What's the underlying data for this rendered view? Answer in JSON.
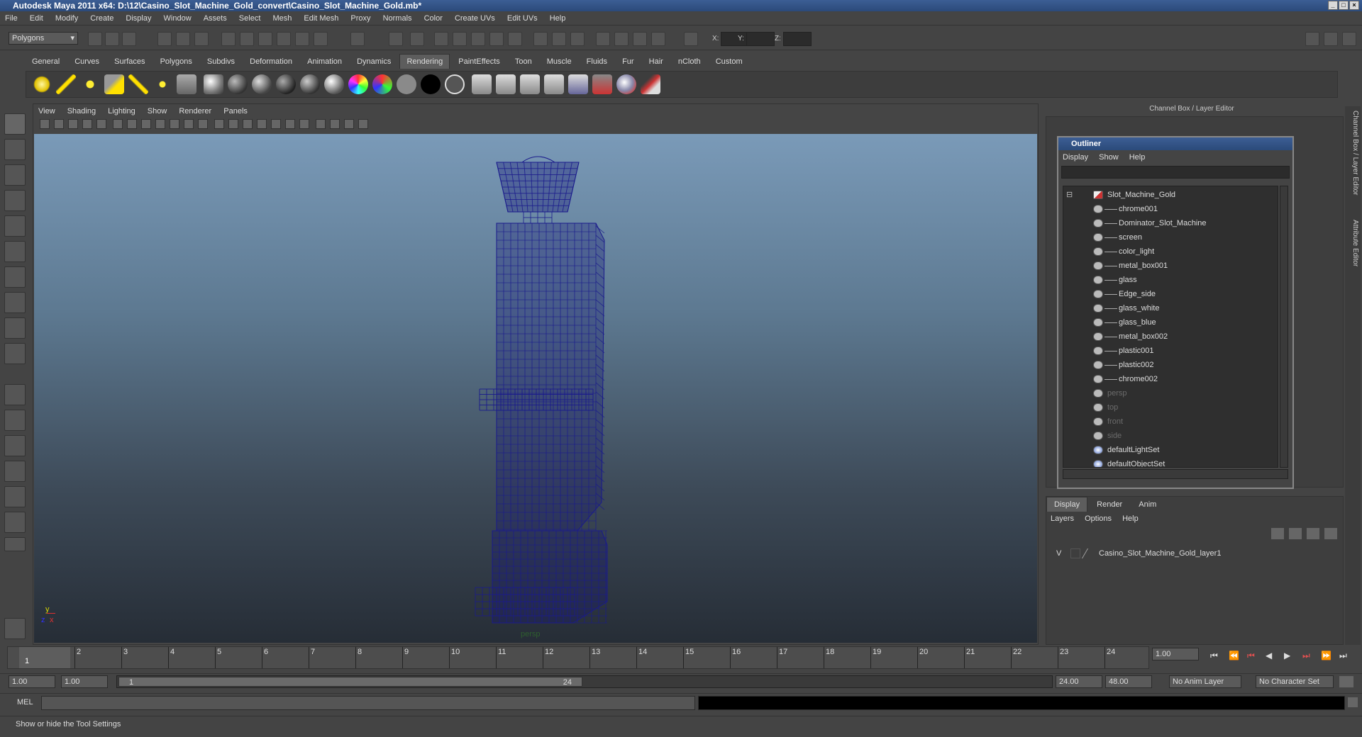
{
  "window": {
    "title": "Autodesk Maya 2011 x64: D:\\12\\Casino_Slot_Machine_Gold_convert\\Casino_Slot_Machine_Gold.mb*"
  },
  "menubar": [
    "File",
    "Edit",
    "Modify",
    "Create",
    "Display",
    "Window",
    "Assets",
    "Select",
    "Mesh",
    "Edit Mesh",
    "Proxy",
    "Normals",
    "Color",
    "Create UVs",
    "Edit UVs",
    "Help"
  ],
  "status_line": {
    "mode": "Polygons",
    "x_label": "X:",
    "y_label": "Y:",
    "z_label": "Z:"
  },
  "shelf_tabs": [
    "General",
    "Curves",
    "Surfaces",
    "Polygons",
    "Subdivs",
    "Deformation",
    "Animation",
    "Dynamics",
    "Rendering",
    "PaintEffects",
    "Toon",
    "Muscle",
    "Fluids",
    "Fur",
    "Hair",
    "nCloth",
    "Custom"
  ],
  "active_shelf_tab": "Rendering",
  "viewport": {
    "menu": [
      "View",
      "Shading",
      "Lighting",
      "Show",
      "Renderer",
      "Panels"
    ],
    "camera_label": "persp",
    "axis_y": "y",
    "axis_z": "z",
    "wire_color": "#1a1a8c"
  },
  "channel_box_header": "Channel Box / Layer Editor",
  "outliner": {
    "title": "Outliner",
    "menu": [
      "Display",
      "Show",
      "Help"
    ],
    "items": [
      {
        "label": "Slot_Machine_Gold",
        "type": "group"
      },
      {
        "label": "chrome001",
        "type": "mesh"
      },
      {
        "label": "Dominator_Slot_Machine",
        "type": "mesh"
      },
      {
        "label": "screen",
        "type": "mesh"
      },
      {
        "label": "color_light",
        "type": "mesh"
      },
      {
        "label": "metal_box001",
        "type": "mesh"
      },
      {
        "label": "glass",
        "type": "mesh"
      },
      {
        "label": "Edge_side",
        "type": "mesh"
      },
      {
        "label": "glass_white",
        "type": "mesh"
      },
      {
        "label": "glass_blue",
        "type": "mesh"
      },
      {
        "label": "metal_box002",
        "type": "mesh"
      },
      {
        "label": "plastic001",
        "type": "mesh"
      },
      {
        "label": "plastic002",
        "type": "mesh"
      },
      {
        "label": "chrome002",
        "type": "mesh"
      },
      {
        "label": "persp",
        "type": "camera"
      },
      {
        "label": "top",
        "type": "camera"
      },
      {
        "label": "front",
        "type": "camera"
      },
      {
        "label": "side",
        "type": "camera"
      },
      {
        "label": "defaultLightSet",
        "type": "set"
      },
      {
        "label": "defaultObjectSet",
        "type": "set"
      }
    ]
  },
  "layer_editor": {
    "tabs": [
      "Display",
      "Render",
      "Anim"
    ],
    "menu": [
      "Layers",
      "Options",
      "Help"
    ],
    "layer_visibility": "V",
    "layer_name": "Casino_Slot_Machine_Gold_layer1"
  },
  "side_tabs": [
    "Channel Box / Layer Editor",
    "Attribute Editor"
  ],
  "timeline": {
    "ticks": [
      "1",
      "2",
      "3",
      "4",
      "5",
      "6",
      "7",
      "8",
      "9",
      "10",
      "11",
      "12",
      "13",
      "14",
      "15",
      "16",
      "17",
      "18",
      "19",
      "20",
      "21",
      "22",
      "23",
      "24"
    ],
    "current_frame": "1",
    "current_time_field": "1.00"
  },
  "range": {
    "start": "1.00",
    "playback_start": "1.00",
    "slider_start": "1",
    "slider_end": "24",
    "playback_end": "24.00",
    "end": "48.00",
    "anim_layer": "No Anim Layer",
    "character_set": "No Character Set"
  },
  "mel_label": "MEL",
  "help_line": "Show or hide the Tool Settings"
}
